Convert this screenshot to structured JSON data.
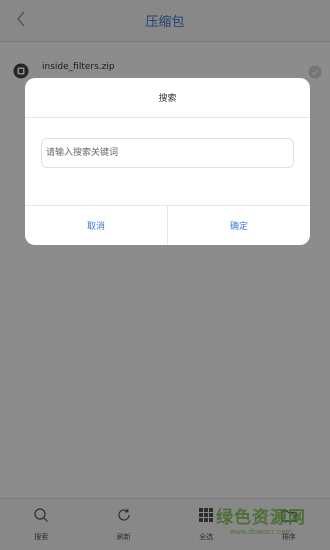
{
  "header": {
    "title": "压缩包"
  },
  "file": {
    "name": "inside_filters.zip"
  },
  "dialog": {
    "title": "搜索",
    "placeholder": "请输入搜索关键词",
    "cancel": "取消",
    "confirm": "确定"
  },
  "bottom_bar": {
    "items": [
      {
        "label": "搜索",
        "icon": "search-icon"
      },
      {
        "label": "刷新",
        "icon": "refresh-icon"
      },
      {
        "label": "全选",
        "icon": "grid-icon"
      },
      {
        "label": "排序",
        "icon": "folder-icon"
      }
    ]
  },
  "watermark": {
    "text": "绿色资源网",
    "url": "www.downcc.com"
  },
  "colors": {
    "accent": "#3a7bd5",
    "overlay": "rgba(0,0,0,0.45)",
    "watermark": "#7ec44a"
  }
}
